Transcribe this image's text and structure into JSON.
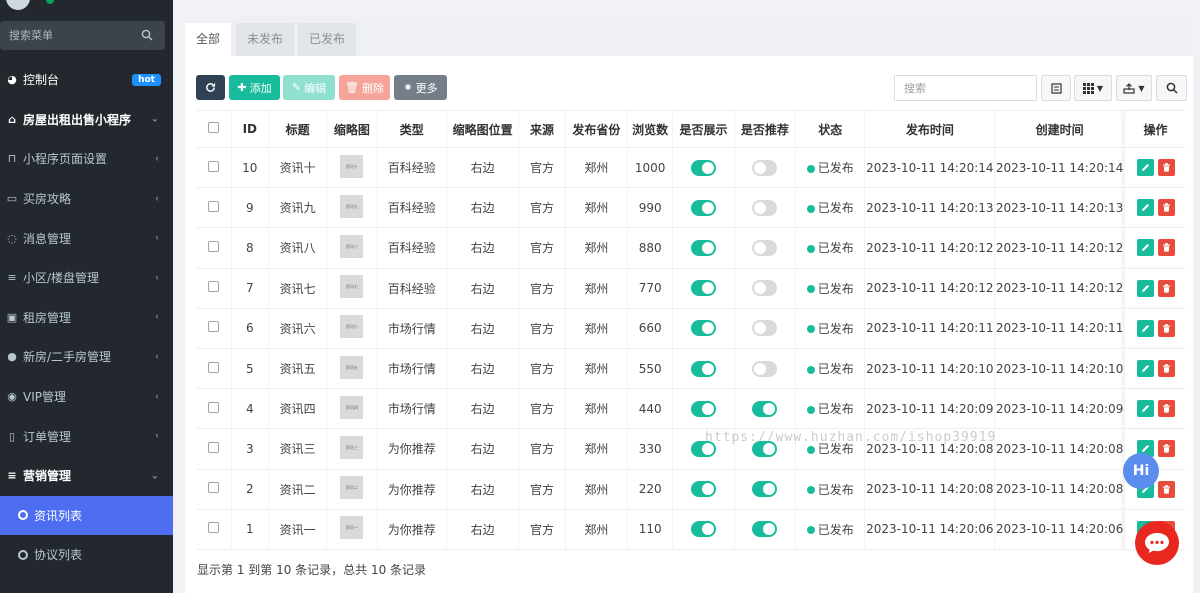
{
  "sidebar": {
    "search_placeholder": "搜索菜单",
    "dashboard": {
      "label": "控制台",
      "badge": "hot"
    },
    "group": {
      "label": "房屋出租出售小程序"
    },
    "items": [
      {
        "label": "小程序页面设置",
        "icon": "bookmark-icon"
      },
      {
        "label": "买房攻略",
        "icon": "file-icon"
      },
      {
        "label": "消息管理",
        "icon": "comment-icon"
      },
      {
        "label": "小区/楼盘管理",
        "icon": "list-icon"
      },
      {
        "label": "租房管理",
        "icon": "square-icon"
      },
      {
        "label": "新房/二手房管理",
        "icon": "map-marker-icon"
      },
      {
        "label": "VIP管理",
        "icon": "vip-icon"
      },
      {
        "label": "订单管理",
        "icon": "order-icon"
      }
    ],
    "marketing": {
      "label": "营销管理",
      "children": [
        {
          "label": "资讯列表",
          "active": true
        },
        {
          "label": "协议列表",
          "active": false
        }
      ]
    }
  },
  "tabs": [
    {
      "label": "全部",
      "active": true
    },
    {
      "label": "未发布",
      "active": false
    },
    {
      "label": "已发布",
      "active": false
    }
  ],
  "toolbar": {
    "add": "添加",
    "edit": "编辑",
    "delete": "删除",
    "more": "更多",
    "search_placeholder": "搜索"
  },
  "table": {
    "columns": [
      "ID",
      "标题",
      "缩略图",
      "类型",
      "缩略图位置",
      "来源",
      "发布省份",
      "浏览数",
      "是否展示",
      "是否推荐",
      "状态",
      "发布时间",
      "创建时间",
      "操作"
    ],
    "rows": [
      {
        "id": "10",
        "title": "资讯十",
        "thumb": "资讯十",
        "type": "百科经验",
        "type_color": "red",
        "position": "右边",
        "source": "官方",
        "province": "郑州",
        "views": "1000",
        "show": true,
        "recommend": false,
        "status": "已发布",
        "publish_time": "2023-10-11 14:20:14",
        "create_time": "2023-10-11 14:20:14"
      },
      {
        "id": "9",
        "title": "资讯九",
        "thumb": "资讯九",
        "type": "百科经验",
        "type_color": "red",
        "position": "右边",
        "source": "官方",
        "province": "郑州",
        "views": "990",
        "show": true,
        "recommend": false,
        "status": "已发布",
        "publish_time": "2023-10-11 14:20:13",
        "create_time": "2023-10-11 14:20:13"
      },
      {
        "id": "8",
        "title": "资讯八",
        "thumb": "资讯八",
        "type": "百科经验",
        "type_color": "red",
        "position": "右边",
        "source": "官方",
        "province": "郑州",
        "views": "880",
        "show": true,
        "recommend": false,
        "status": "已发布",
        "publish_time": "2023-10-11 14:20:12",
        "create_time": "2023-10-11 14:20:12"
      },
      {
        "id": "7",
        "title": "资讯七",
        "thumb": "资讯七",
        "type": "百科经验",
        "type_color": "red",
        "position": "右边",
        "source": "官方",
        "province": "郑州",
        "views": "770",
        "show": true,
        "recommend": false,
        "status": "已发布",
        "publish_time": "2023-10-11 14:20:12",
        "create_time": "2023-10-11 14:20:12"
      },
      {
        "id": "6",
        "title": "资讯六",
        "thumb": "资讯六",
        "type": "市场行情",
        "type_color": "green",
        "position": "右边",
        "source": "官方",
        "province": "郑州",
        "views": "660",
        "show": true,
        "recommend": false,
        "status": "已发布",
        "publish_time": "2023-10-11 14:20:11",
        "create_time": "2023-10-11 14:20:11"
      },
      {
        "id": "5",
        "title": "资讯五",
        "thumb": "资讯五",
        "type": "市场行情",
        "type_color": "green",
        "position": "右边",
        "source": "官方",
        "province": "郑州",
        "views": "550",
        "show": true,
        "recommend": false,
        "status": "已发布",
        "publish_time": "2023-10-11 14:20:10",
        "create_time": "2023-10-11 14:20:10"
      },
      {
        "id": "4",
        "title": "资讯四",
        "thumb": "资讯四",
        "type": "市场行情",
        "type_color": "green",
        "position": "右边",
        "source": "官方",
        "province": "郑州",
        "views": "440",
        "show": true,
        "recommend": true,
        "status": "已发布",
        "publish_time": "2023-10-11 14:20:09",
        "create_time": "2023-10-11 14:20:09"
      },
      {
        "id": "3",
        "title": "资讯三",
        "thumb": "资讯三",
        "type": "为你推荐",
        "type_color": "plain",
        "position": "右边",
        "source": "官方",
        "province": "郑州",
        "views": "330",
        "show": true,
        "recommend": true,
        "status": "已发布",
        "publish_time": "2023-10-11 14:20:08",
        "create_time": "2023-10-11 14:20:08"
      },
      {
        "id": "2",
        "title": "资讯二",
        "thumb": "资讯二",
        "type": "为你推荐",
        "type_color": "plain",
        "position": "右边",
        "source": "官方",
        "province": "郑州",
        "views": "220",
        "show": true,
        "recommend": true,
        "status": "已发布",
        "publish_time": "2023-10-11 14:20:08",
        "create_time": "2023-10-11 14:20:08"
      },
      {
        "id": "1",
        "title": "资讯一",
        "thumb": "资讯一",
        "type": "为你推荐",
        "type_color": "plain",
        "position": "右边",
        "source": "官方",
        "province": "郑州",
        "views": "110",
        "show": true,
        "recommend": true,
        "status": "已发布",
        "publish_time": "2023-10-11 14:20:06",
        "create_time": "2023-10-11 14:20:06"
      }
    ]
  },
  "pagination_text": "显示第 1 到第 10 条记录，总共 10 条记录",
  "watermark": "https://www.huzhan.com/ishop39919",
  "hi_label": "Hi",
  "colors": {
    "accent": "#18bc9c",
    "danger": "#e74c3c",
    "sidebar_bg": "#22282e",
    "active_menu": "#4e6ef2"
  }
}
